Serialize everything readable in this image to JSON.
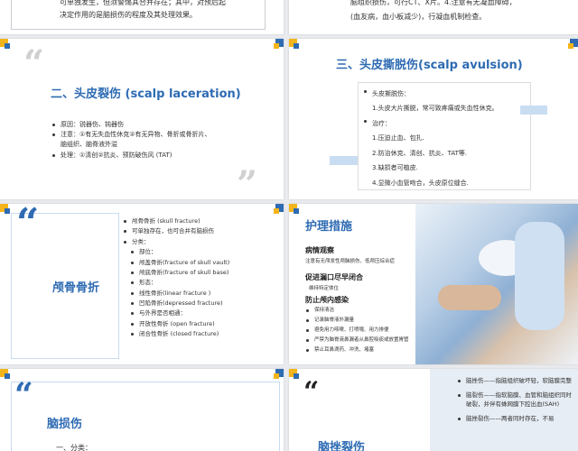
{
  "s1": {
    "line1": "可单独发生，但须警惕其合并存在；其中，对预后起",
    "line2": "决定作用的是脑损伤的程度及其处理效果。"
  },
  "s2": {
    "line1": "脑组织损伤，可行CT、X片。4.注意有无凝血障碍，",
    "line2": "(血友病，血小板减少)，行凝血机制检查。"
  },
  "s3": {
    "title": "二、头皮裂伤 (scalp laceration)",
    "items": [
      "原因：锐器伤、钝器伤",
      "注意：①有无失血性休克②有无异物、骨折或骨折片、",
      "脑组织、脑脊液外溢",
      "处理：①清创②抗炎、预防破伤风 (TAT)"
    ]
  },
  "s4": {
    "title": "三、头皮撕脱伤(scalp avulsion)",
    "items": [
      "头皮撕脱伤：",
      "1.头皮大片撕脱，常可致疼痛或失血性休克。",
      "治疗：",
      "1.压迫止血、包扎.",
      "2.防治休克、清创、抗炎、TAT等.",
      "3.缺损者可植皮.",
      "4.显微小血管吻合，头皮原位缝合."
    ]
  },
  "s5": {
    "title": "颅骨骨折",
    "items": [
      "颅骨骨折 (skull fracture)",
      "可单独存在，也可合并有脑损伤",
      "分类：",
      "部位：",
      "颅盖骨折(fracture of skull vault)",
      "颅底骨折(fracture of skull base)",
      "形态：",
      "线性骨折(linear fracture )",
      "凹陷骨折(depressed fracture)",
      "与外界是否相通：",
      "开放性骨折 (open fracture)",
      "闭合性骨折 (closed fracture)"
    ]
  },
  "s6": {
    "title": "护理措施",
    "h1": "病情观察",
    "t1": "注意有无颅发性颅脑损伤、低颅压综合症",
    "h2": "促进漏口尽早闭合",
    "t2": "维持特定体位",
    "h3": "防止颅内感染",
    "items": [
      "保持清洁",
      "记录脑脊液外漏量",
      "避免用力咳嗽、打喷嚏、用力排便",
      "严禁为脑脊液鼻漏者从鼻腔吸痰或放置胃管",
      "禁止耳鼻滴药、冲洗、堵塞"
    ]
  },
  "s7": {
    "title": "脑损伤",
    "sub": "一、分类："
  },
  "s8": {
    "title": "脑挫裂伤",
    "items": [
      "脑挫伤——指脑组织破坏轻，软脑膜完整",
      "脑裂伤——指软脑膜、血管和脑组织同时破裂，并伴有蛛网膜下腔出血(SAH)",
      "脑挫裂伤——两者同时存在，不易"
    ]
  },
  "colors": {
    "accent": "#2e6bb3",
    "yellow": "#f3b51b",
    "light_blue": "#c9ddf2"
  }
}
